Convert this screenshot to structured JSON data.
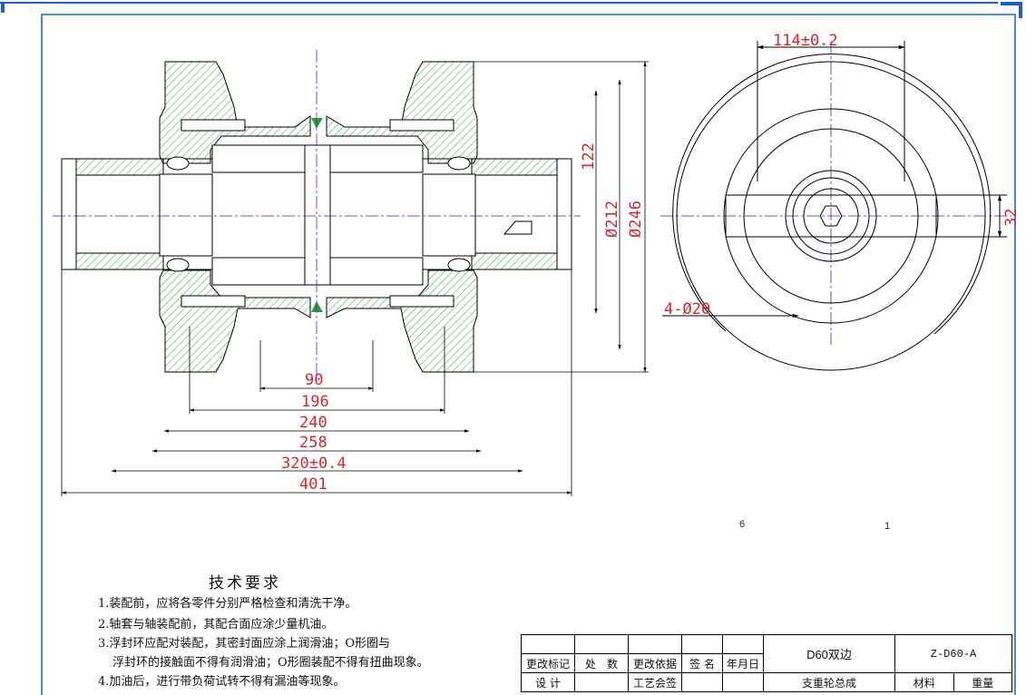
{
  "drawing": {
    "dimensions": {
      "d90": "90",
      "d196": "196",
      "d240": "240",
      "d258": "258",
      "d320": "320±0.4",
      "d401": "401",
      "d122": "122",
      "d212": "Ø212",
      "d246": "Ø246",
      "d114": "114±0.2",
      "d32": "32",
      "holes": "4-Ø20"
    },
    "view_labels": {
      "label_6": "6",
      "label_1": "1"
    }
  },
  "tech_requirements": {
    "title": "技术要求",
    "items": [
      "1.装配前，应将各零件分别严格检查和清洗干净。",
      "2.轴套与轴装配前，其配合面应涂少量机油。",
      "3.浮封环应配对装配，其密封面应涂上润滑油；O形圈与",
      "浮封环的接触面不得有润滑油；O形圈装配不得有扭曲现象。",
      "4.加油后，进行带负荷试转不得有漏油等现象。"
    ]
  },
  "title_block": {
    "h_mark": "更改标记",
    "h_count": "处　数",
    "h_basis": "更改依据",
    "h_sign": "签 名",
    "h_date": "年月日",
    "designer": "设  计",
    "process": "工艺会签",
    "product_model": "D60双边",
    "product_name": "支重轮总成",
    "drawing_no": "Z-D60-A",
    "material": "材料",
    "weight": "重量"
  },
  "colors": {
    "outline": "#000000",
    "hatch": "#2e9e2e",
    "dimension": "#d4262c",
    "centerline": "#2b2bd6",
    "frame": "#1a5fd0"
  }
}
